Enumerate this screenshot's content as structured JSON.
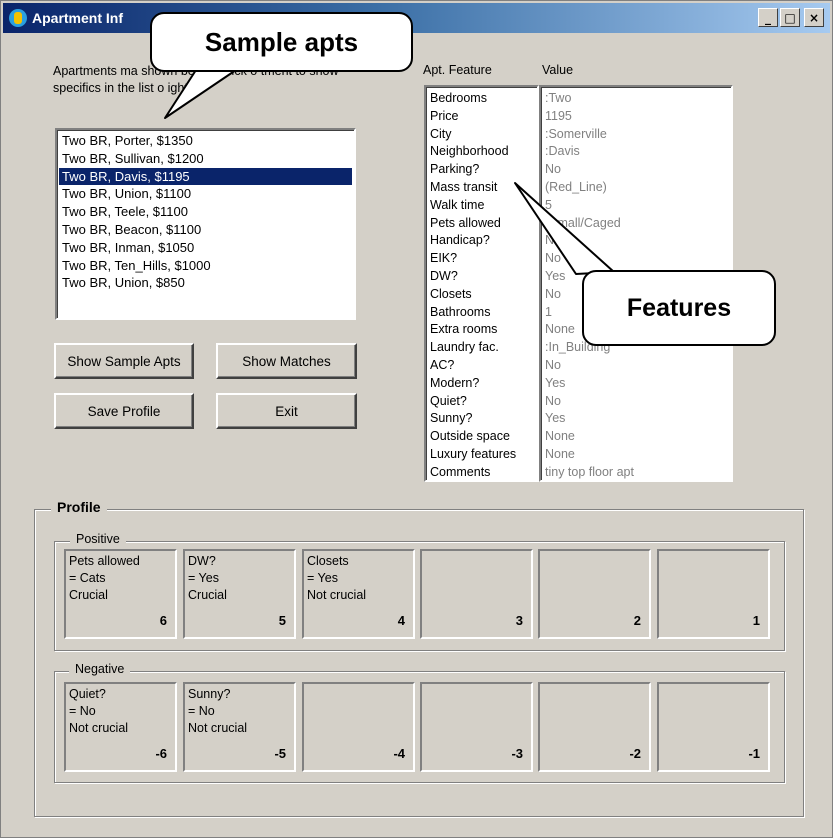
{
  "window": {
    "title": "Apartment Inf",
    "minimize": "_",
    "maximize": "□",
    "close": "×"
  },
  "instructions": "Apartments ma shown below. Click o tment to show specifics in the list o ight.",
  "apartments": [
    "Two BR, Porter, $1350",
    "Two BR, Sullivan, $1200",
    "Two BR, Davis, $1195",
    "Two BR, Union, $1100",
    "Two BR, Teele, $1100",
    "Two BR, Beacon, $1100",
    "Two BR, Inman, $1050",
    "Two BR, Ten_Hills, $1000",
    "Two BR, Union, $850"
  ],
  "selected_index": 2,
  "buttons": {
    "show_sample": "Show Sample Apts",
    "show_matches": "Show Matches",
    "save_profile": "Save Profile",
    "exit": "Exit"
  },
  "features_header": "Apt. Feature",
  "value_header": "Value",
  "features": [
    {
      "label": "Bedrooms",
      "value": ":Two"
    },
    {
      "label": "Price",
      "value": "1195"
    },
    {
      "label": "City",
      "value": ":Somerville"
    },
    {
      "label": "Neighborhood",
      "value": ":Davis"
    },
    {
      "label": "Parking?",
      "value": "No"
    },
    {
      "label": "Mass transit",
      "value": "(Red_Line)"
    },
    {
      "label": "Walk time",
      "value": "5"
    },
    {
      "label": "Pets allowed",
      "value": "(Small/Caged"
    },
    {
      "label": "Handicap?",
      "value": "No"
    },
    {
      "label": "EIK?",
      "value": "No"
    },
    {
      "label": "DW?",
      "value": "Yes"
    },
    {
      "label": "Closets",
      "value": "No"
    },
    {
      "label": "Bathrooms",
      "value": "1"
    },
    {
      "label": "Extra rooms",
      "value": "None"
    },
    {
      "label": "Laundry fac.",
      "value": ":In_Building"
    },
    {
      "label": "AC?",
      "value": "No"
    },
    {
      "label": "Modern?",
      "value": "Yes"
    },
    {
      "label": "Quiet?",
      "value": "No"
    },
    {
      "label": "Sunny?",
      "value": "Yes"
    },
    {
      "label": "Outside space",
      "value": "None"
    },
    {
      "label": "Luxury features",
      "value": "None"
    },
    {
      "label": "Comments",
      "value": "tiny top floor apt"
    }
  ],
  "profile": {
    "title": "Profile",
    "positive_label": "Positive",
    "negative_label": "Negative",
    "positive": [
      {
        "text": "Pets allowed\n= Cats\nCrucial",
        "rank": "6"
      },
      {
        "text": "DW?\n= Yes\nCrucial",
        "rank": "5"
      },
      {
        "text": "Closets\n= Yes\nNot crucial",
        "rank": "4"
      },
      {
        "text": "",
        "rank": "3"
      },
      {
        "text": "",
        "rank": "2"
      },
      {
        "text": "",
        "rank": "1"
      }
    ],
    "negative": [
      {
        "text": "Quiet?\n= No\nNot crucial",
        "rank": "-6"
      },
      {
        "text": "Sunny?\n= No\nNot crucial",
        "rank": "-5"
      },
      {
        "text": "",
        "rank": "-4"
      },
      {
        "text": "",
        "rank": "-3"
      },
      {
        "text": "",
        "rank": "-2"
      },
      {
        "text": "",
        "rank": "-1"
      }
    ]
  },
  "callouts": {
    "sample": "Sample apts",
    "features": "Features"
  }
}
